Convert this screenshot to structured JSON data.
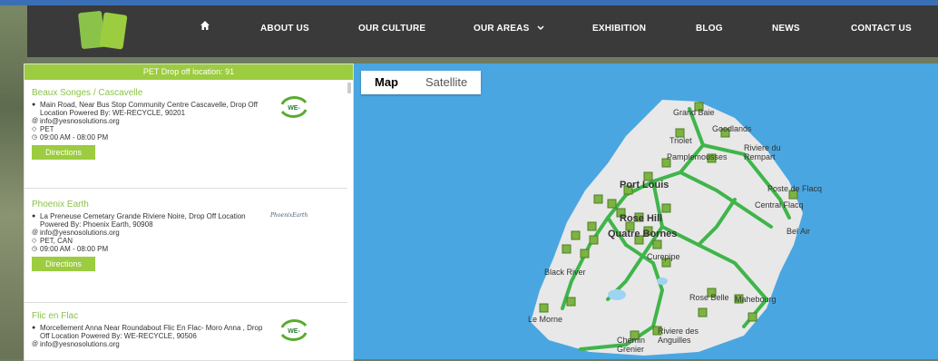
{
  "nav": {
    "items": [
      "ABOUT US",
      "OUR CULTURE",
      "OUR AREAS",
      "EXHIBITION",
      "BLOG",
      "NEWS",
      "CONTACT US"
    ],
    "icons": [
      "home-icon",
      "chevron-down-icon"
    ]
  },
  "panel": {
    "header": "PET Drop off location: 91",
    "entries": [
      {
        "title": "Beaux Songes / Cascavelle",
        "address": "Main Road, Near Bus Stop Community Centre Cascavelle, Drop Off Location Powered By: WE-RECYCLE, 90201",
        "email": "info@yesnosolutions.org",
        "materials": "PET",
        "hours": "09:00 AM - 08:00 PM",
        "button": "Directions",
        "logo_text": "WE-"
      },
      {
        "title": "Phoenix Earth",
        "address": "La Preneuse Cemetary Grande Riviere Noire, Drop Off Location Powered By: Phoenix Earth, 90908",
        "email": "info@yesnosolutions.org",
        "materials": "PET, CAN",
        "hours": "09:00 AM - 08:00 PM",
        "button": "Directions",
        "logo_text": "PhoenixEarth"
      },
      {
        "title": "Flic en Flac",
        "address": "Morcellement Anna Near Roundabout Flic En Flac- Moro Anna , Drop Off Location Powered By: WE-RECYCLE, 90506",
        "email": "info@yesnosolutions.org",
        "logo_text": "WE-"
      }
    ]
  },
  "map": {
    "tabs": [
      "Map",
      "Satellite"
    ],
    "labels": [
      "Grand Baie",
      "Goodlands",
      "Triolet",
      "Riviere du Rempart",
      "Pamplemousses",
      "Port Louis",
      "Poste de Flacq",
      "Central Flacq",
      "Rose Hill",
      "Quatre Bornes",
      "Bel Air",
      "Curepipe",
      "Black River",
      "Rose Belle",
      "Mahebourg",
      "Le Morne",
      "Riviere des Anguilles",
      "Chemin Grenier"
    ]
  }
}
